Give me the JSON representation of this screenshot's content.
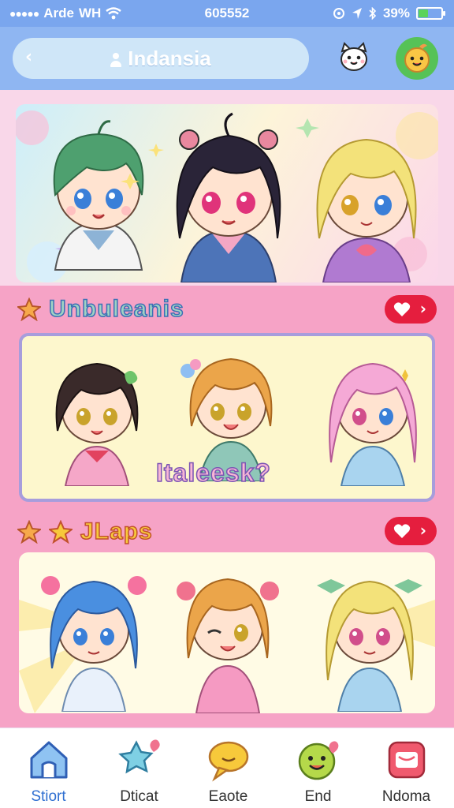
{
  "status_bar": {
    "carrier": "Arde",
    "network": "WH",
    "time": "605552",
    "battery": "39%",
    "battery_level": 0.39
  },
  "header": {
    "back_icon": "back-chevron-icon",
    "search_label": "Indansia",
    "buttons": [
      {
        "icon": "cat-face-icon"
      },
      {
        "icon": "chick-face-icon"
      }
    ]
  },
  "sections": [
    {
      "title": "Unbuleanis",
      "badge_icon": "heart-icon",
      "sticker_caption": "Italeesk?"
    },
    {
      "title": "JLaps",
      "badge_icon": "heart-icon"
    }
  ],
  "nav": {
    "items": [
      {
        "label": "Stiort",
        "icon": "home-icon",
        "active": true
      },
      {
        "label": "Dticat",
        "icon": "star-chat-icon",
        "active": false
      },
      {
        "label": "Eaote",
        "icon": "speech-bubble-icon",
        "active": false
      },
      {
        "label": "End",
        "icon": "smiley-icon",
        "active": false
      },
      {
        "label": "Ndoma",
        "icon": "message-box-icon",
        "active": false
      }
    ]
  },
  "colors": {
    "status_bar": "#7aa6ee",
    "header": "#8fb6f2",
    "page_pink": "#f6a3c6",
    "accent_red": "#e51e3e",
    "nav_active": "#2f6fd1"
  }
}
